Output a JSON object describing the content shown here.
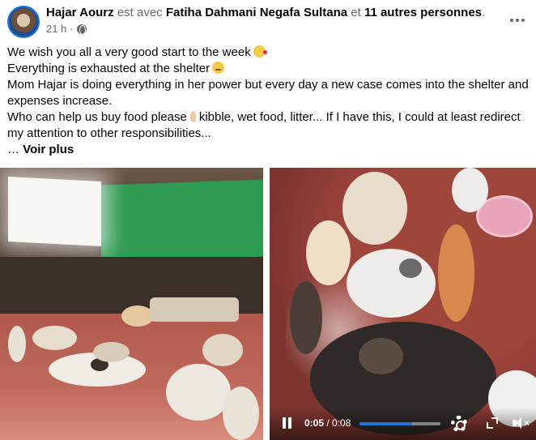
{
  "post": {
    "author": "Hajar Aourz",
    "with_text": "est avec",
    "tagged": "Fatiha Dahmani Negafa Sultana",
    "and_text": "et",
    "others": "11 autres personnes",
    "period": ".",
    "time": "21 h",
    "separator": "·",
    "privacy_icon": "globe-icon",
    "more_icon": "more-options-icon",
    "lines": {
      "l1": "We wish you all a very good start to the week",
      "l2": "Everything is exhausted at the shelter",
      "l3": "Mom Hajar is doing everything in her power but every day a new case comes into the shelter and expenses increase.",
      "l4a": "Who can help us buy food please",
      "l4b": "kibble, wet food, litter... If I have this, I could at least redirect my attention to other responsibilities...",
      "ellipsis": "…",
      "see_more": "Voir plus"
    }
  },
  "video": {
    "current": "0:05",
    "sep": " / ",
    "duration": "0:08",
    "progress_fraction": 0.65,
    "accent": "#1b74e4",
    "mute_glyph": "×"
  }
}
